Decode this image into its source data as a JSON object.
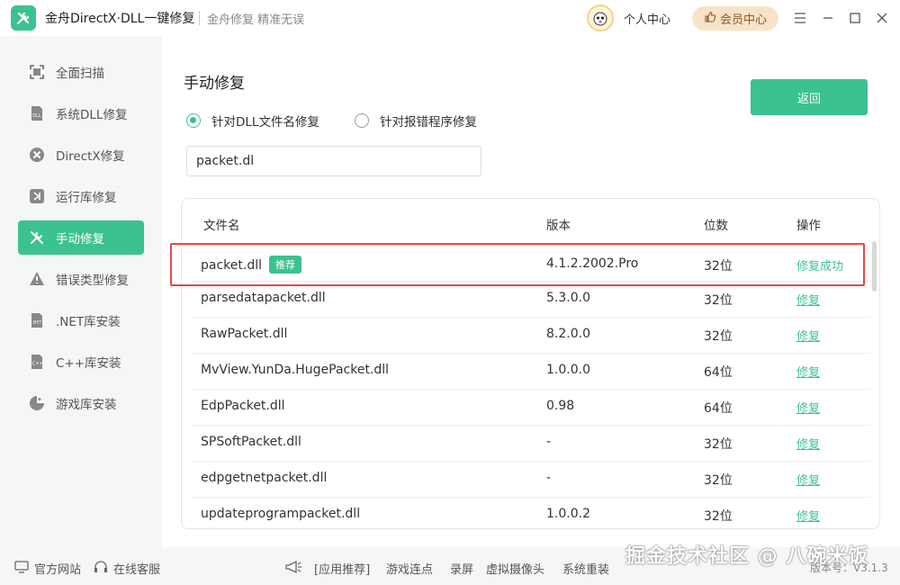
{
  "app": {
    "title": "金舟DirectX·DLL一键修复",
    "slogan": "金舟修复 精准无误",
    "profile_label": "个人中心",
    "vip_label": "会员中心",
    "accent": "#3cc28f"
  },
  "sidebar": {
    "items": [
      {
        "label": "全面扫描",
        "icon": "scan-icon"
      },
      {
        "label": "系统DLL修复",
        "icon": "dll-icon"
      },
      {
        "label": "DirectX修复",
        "icon": "directx-icon"
      },
      {
        "label": "运行库修复",
        "icon": "runtime-icon"
      },
      {
        "label": "手动修复",
        "icon": "wrench-icon",
        "active": true
      },
      {
        "label": "错误类型修复",
        "icon": "warning-icon"
      },
      {
        "label": ".NET库安装",
        "icon": "dotnet-icon"
      },
      {
        "label": "C++库安装",
        "icon": "cpp-icon"
      },
      {
        "label": "游戏库安装",
        "icon": "game-icon"
      }
    ]
  },
  "main": {
    "title": "手动修复",
    "back_label": "返回",
    "radio_by_name": "针对DLL文件名修复",
    "radio_by_program": "针对报错程序修复",
    "search_value": "packet.dl",
    "table": {
      "headers": [
        "文件名",
        "版本",
        "位数",
        "操作"
      ],
      "rows": [
        {
          "name": "packet.dll",
          "badge": "推荐",
          "version": "4.1.2.2002.Pro",
          "bits": "32位",
          "action": "修复成功"
        },
        {
          "name": "parsedatapacket.dll",
          "version": "5.3.0.0",
          "bits": "32位",
          "action": "修复"
        },
        {
          "name": "RawPacket.dll",
          "version": "8.2.0.0",
          "bits": "32位",
          "action": "修复"
        },
        {
          "name": "MvView.YunDa.HugePacket.dll",
          "version": "1.0.0.0",
          "bits": "64位",
          "action": "修复"
        },
        {
          "name": "EdpPacket.dll",
          "version": "0.98",
          "bits": "64位",
          "action": "修复"
        },
        {
          "name": "SPSoftPacket.dll",
          "version": "-",
          "bits": "32位",
          "action": "修复"
        },
        {
          "name": "edpgetnetpacket.dll",
          "version": "-",
          "bits": "32位",
          "action": "修复"
        },
        {
          "name": "updateprogrampacket.dll",
          "version": "1.0.0.2",
          "bits": "32位",
          "action": "修复"
        }
      ]
    }
  },
  "footer": {
    "website": "官方网站",
    "support": "在线客服",
    "links": [
      "[应用推荐]",
      "游戏连点",
      "录屏",
      "虚拟摄像头",
      "系统重装"
    ],
    "version": "版本号：V3.1.3",
    "watermark": "掘金技术社区 @ 八碗米饭"
  }
}
